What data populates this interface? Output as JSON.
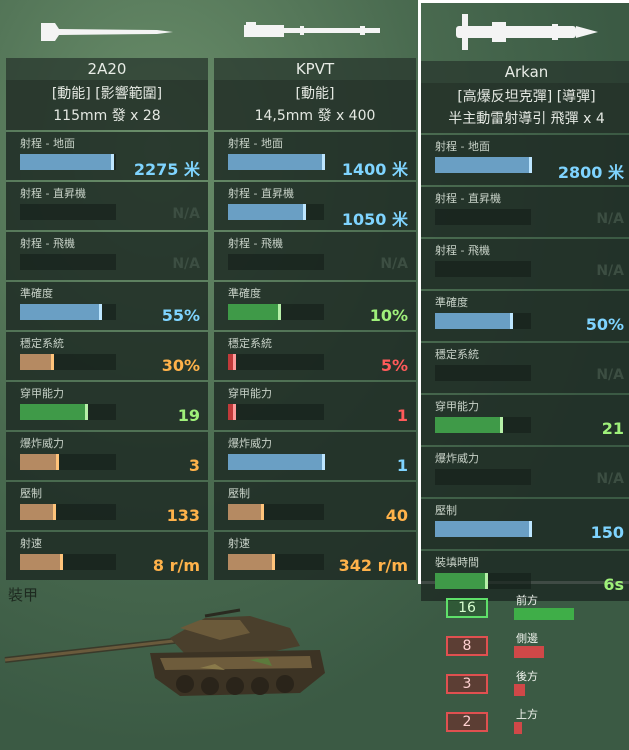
{
  "weapons": [
    {
      "name": "2A20",
      "tags": "[動能] [影響範圍]",
      "ammo": "115mm 發 x 28",
      "icon": "shell-icon",
      "stats": [
        {
          "label": "射程 - 地面",
          "value": "2275 米",
          "color": "blue",
          "level": 0.95
        },
        {
          "label": "射程 - 直昇機",
          "value": "N/A",
          "color": "na",
          "level": 0
        },
        {
          "label": "射程 - 飛機",
          "value": "N/A",
          "color": "na",
          "level": 0
        },
        {
          "label": "準確度",
          "value": "55%",
          "color": "blue",
          "level": 0.82
        },
        {
          "label": "穩定系統",
          "value": "30%",
          "color": "orange",
          "level": 0.32
        },
        {
          "label": "穿甲能力",
          "value": "19",
          "color": "green",
          "level": 0.68
        },
        {
          "label": "爆炸威力",
          "value": "3",
          "color": "orange",
          "level": 0.38
        },
        {
          "label": "壓制",
          "value": "133",
          "color": "orange",
          "level": 0.34
        },
        {
          "label": "射速",
          "value": "8 r/m",
          "color": "orange",
          "level": 0.42
        }
      ]
    },
    {
      "name": "KPVT",
      "tags": "[動能]",
      "ammo": "14,5mm 發 x 400",
      "icon": "machine-gun-icon",
      "stats": [
        {
          "label": "射程 - 地面",
          "value": "1400 米",
          "color": "blue",
          "level": 0.98
        },
        {
          "label": "射程 - 直昇機",
          "value": "1050 米",
          "color": "blue",
          "level": 0.78
        },
        {
          "label": "射程 - 飛機",
          "value": "N/A",
          "color": "na",
          "level": 0
        },
        {
          "label": "準確度",
          "value": "10%",
          "color": "green",
          "level": 0.52
        },
        {
          "label": "穩定系統",
          "value": "5%",
          "color": "red",
          "level": 0.05
        },
        {
          "label": "穿甲能力",
          "value": "1",
          "color": "red",
          "level": 0.05
        },
        {
          "label": "爆炸威力",
          "value": "1",
          "color": "blue",
          "level": 0.98
        },
        {
          "label": "壓制",
          "value": "40",
          "color": "orange",
          "level": 0.34
        },
        {
          "label": "射速",
          "value": "342 r/m",
          "color": "orange",
          "level": 0.46
        }
      ]
    },
    {
      "name": "Arkan",
      "tags": "[高爆反坦克彈] [導彈]",
      "ammo": "半主動雷射導引 飛彈 x 4",
      "icon": "missile-icon",
      "stats": [
        {
          "label": "射程 - 地面",
          "value": "2800 米",
          "color": "blue",
          "level": 0.98
        },
        {
          "label": "射程 - 直昇機",
          "value": "N/A",
          "color": "na",
          "level": 0
        },
        {
          "label": "射程 - 飛機",
          "value": "N/A",
          "color": "na",
          "level": 0
        },
        {
          "label": "準確度",
          "value": "50%",
          "color": "blue",
          "level": 0.78
        },
        {
          "label": "穩定系統",
          "value": "N/A",
          "color": "na",
          "level": 0
        },
        {
          "label": "穿甲能力",
          "value": "21",
          "color": "green",
          "level": 0.68
        },
        {
          "label": "爆炸威力",
          "value": "N/A",
          "color": "na",
          "level": 0
        },
        {
          "label": "壓制",
          "value": "150",
          "color": "blue",
          "level": 0.98
        },
        {
          "label": "裝填時間",
          "value": "6s",
          "color": "green",
          "level": 0.52
        }
      ]
    }
  ],
  "armor": {
    "title": "裝甲",
    "items": [
      {
        "value": "16",
        "label": "前方",
        "color": "green",
        "level": 1.0
      },
      {
        "value": "8",
        "label": "側邊",
        "color": "red",
        "level": 0.5
      },
      {
        "value": "3",
        "label": "後方",
        "color": "red",
        "level": 0.19
      },
      {
        "value": "2",
        "label": "上方",
        "color": "red",
        "level": 0.13
      }
    ]
  }
}
